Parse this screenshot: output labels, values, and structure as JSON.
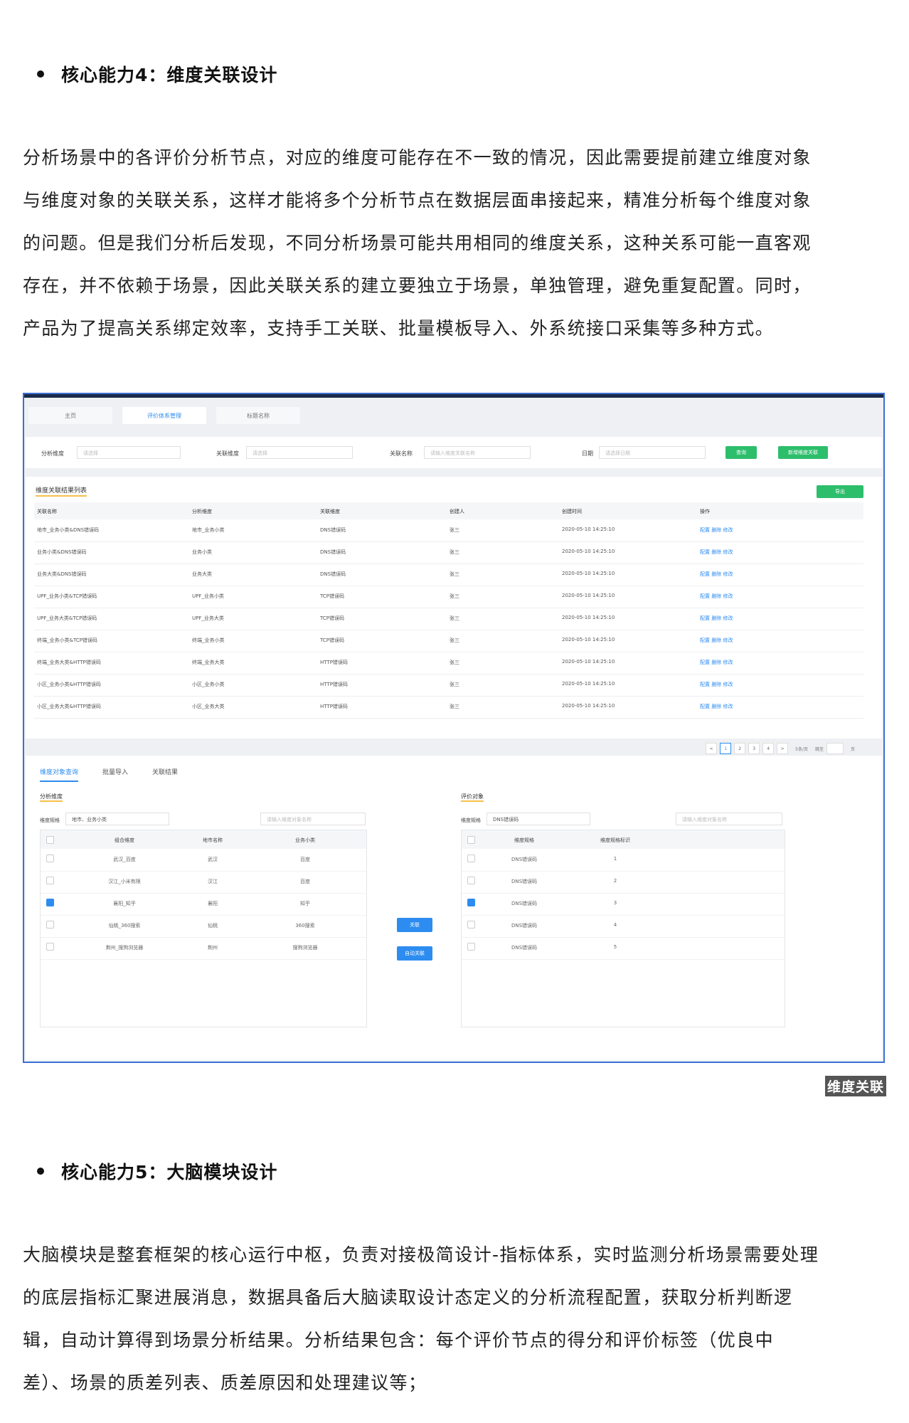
{
  "section4": {
    "heading": "核心能力4：维度关联设计",
    "paragraph_lines": [
      "分析场景中的各评价分析节点，对应的维度可能存在不一致的情况，因此需要提前建立维度对象",
      "与维度对象的关联关系，这样才能将多个分析节点在数据层面串接起来，精准分析每个维度对象",
      "的问题。但是我们分析后发现，不同分析场景可能共用相同的维度关系，这种关系可能一直客观",
      "存在，并不依赖于场景，因此关联关系的建立要独立于场景，单独管理，避免重复配置。同时，",
      "产品为了提高关系绑定效率，支持手工关联、批量模板导入、外系统接口采集等多种方式。"
    ]
  },
  "screenshot": {
    "tabs": [
      "主页",
      "评价体系管理",
      "标题名称"
    ],
    "filter": {
      "analysis_dim_label": "分析维度",
      "analysis_dim_placeholder": "请选择",
      "link_dim_label": "关联维度",
      "link_dim_placeholder": "请选择",
      "link_name_label": "关联名称",
      "link_name_placeholder": "请输入维度关联名称",
      "date_label": "日期",
      "date_placeholder": "请选择日期",
      "query_button": "查询",
      "add_button": "新增维度关联"
    },
    "result": {
      "title": "维度关联结果列表",
      "export_button": "导出",
      "headers": [
        "关联名称",
        "分析维度",
        "关联维度",
        "创建人",
        "创建时间",
        "操作"
      ],
      "rows": [
        [
          "地市_业务小类&DNS错误码",
          "地市_业务小类",
          "DNS错误码",
          "张三",
          "2020-05-10 14:25:10",
          "配置 删除 修改"
        ],
        [
          "业务小类&DNS错误码",
          "业务小类",
          "DNS错误码",
          "张三",
          "2020-05-10 14:25:10",
          "配置 删除 修改"
        ],
        [
          "业务大类&DNS错误码",
          "业务大类",
          "DNS错误码",
          "张三",
          "2020-05-10 14:25:10",
          "配置 删除 修改"
        ],
        [
          "UPF_业务小类&TCP错误码",
          "UPF_业务小类",
          "TCP错误码",
          "张三",
          "2020-05-10 14:25:10",
          "配置 删除 修改"
        ],
        [
          "UPF_业务大类&TCP错误码",
          "UPF_业务大类",
          "TCP错误码",
          "张三",
          "2020-05-10 14:25:10",
          "配置 删除 修改"
        ],
        [
          "终端_业务小类&TCP错误码",
          "终端_业务小类",
          "TCP错误码",
          "张三",
          "2020-05-10 14:25:10",
          "配置 删除 修改"
        ],
        [
          "终端_业务大类&HTTP错误码",
          "终端_业务大类",
          "HTTP错误码",
          "张三",
          "2020-05-10 14:25:10",
          "配置 删除 修改"
        ],
        [
          "小区_业务小类&HTTP错误码",
          "小区_业务小类",
          "HTTP错误码",
          "张三",
          "2020-05-10 14:25:10",
          "配置 删除 修改"
        ],
        [
          "小区_业务大类&HTTP错误码",
          "小区_业务大类",
          "HTTP错误码",
          "张三",
          "2020-05-10 14:25:10",
          "配置 删除 修改"
        ]
      ],
      "pager": [
        "<",
        "1",
        "2",
        "3",
        "4",
        ">",
        "5条/页",
        "跳至",
        "页"
      ]
    },
    "bottom": {
      "tabs": [
        "维度对象查询",
        "批量导入",
        "关联结果"
      ],
      "left": {
        "title": "分析维度",
        "spec_label": "维度规格",
        "spec_value": "地市、业务小类",
        "search_placeholder": "请输入维度对象名称",
        "headers": [
          "组合维度",
          "地市名称",
          "业务小类"
        ],
        "rows": [
          {
            "checked": false,
            "cells": [
              "武汉_百度",
              "武汉",
              "百度"
            ]
          },
          {
            "checked": false,
            "cells": [
              "汉江_小米有限",
              "汉江",
              "百度"
            ]
          },
          {
            "checked": true,
            "cells": [
              "襄阳_知乎",
              "襄阳",
              "知乎"
            ]
          },
          {
            "checked": false,
            "cells": [
              "仙桃_360搜索",
              "仙桃",
              "360搜索"
            ]
          },
          {
            "checked": false,
            "cells": [
              "荆州_搜狗浏览器",
              "荆州",
              "搜狗浏览器"
            ]
          }
        ]
      },
      "middle": {
        "link_button": "关联",
        "auto_button": "自动关联"
      },
      "right": {
        "title": "评价对象",
        "spec_label": "维度规格",
        "spec_value": "DNS错误码",
        "search_placeholder": "请输入维度对象名称",
        "headers": [
          "维度规格",
          "维度规格标识"
        ],
        "rows": [
          {
            "checked": false,
            "cells": [
              "DNS错误码",
              "1"
            ]
          },
          {
            "checked": false,
            "cells": [
              "DNS错误码",
              "2"
            ]
          },
          {
            "checked": true,
            "cells": [
              "DNS错误码",
              "3"
            ]
          },
          {
            "checked": false,
            "cells": [
              "DNS错误码",
              "4"
            ]
          },
          {
            "checked": false,
            "cells": [
              "DNS错误码",
              "5"
            ]
          }
        ]
      }
    }
  },
  "caption": "维度关联",
  "section5": {
    "heading": "核心能力5：大脑模块设计",
    "paragraph_lines": [
      "大脑模块是整套框架的核心运行中枢，负责对接极简设计-指标体系，实时监测分析场景需要处理",
      "的底层指标汇聚进展消息，数据具备后大脑读取设计态定义的分析流程配置，获取分析判断逻",
      "辑，自动计算得到场景分析结果。分析结果包含：每个评价节点的得分和评价标签（优良中",
      "差）、场景的质差列表、质差原因和处理建议等；"
    ]
  }
}
